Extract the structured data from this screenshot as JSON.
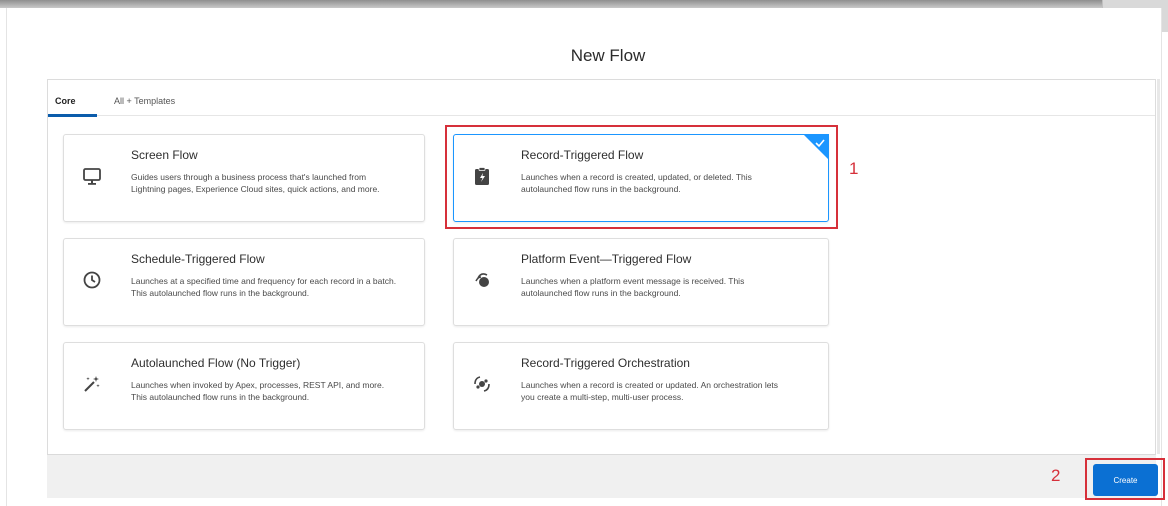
{
  "modal": {
    "title": "New Flow"
  },
  "tabs": [
    {
      "label": "Core",
      "active": true
    },
    {
      "label": "All + Templates",
      "active": false
    }
  ],
  "cards": [
    {
      "title": "Screen Flow",
      "description": "Guides users through a business process that's launched from Lightning pages, Experience Cloud sites, quick actions, and more.",
      "icon": "monitor-icon",
      "selected": false
    },
    {
      "title": "Record-Triggered Flow",
      "description": "Launches when a record is created, updated, or deleted. This autolaunched flow runs in the background.",
      "icon": "clipboard-bolt-icon",
      "selected": true
    },
    {
      "title": "Schedule-Triggered Flow",
      "description": "Launches at a specified time and frequency for each record in a batch. This autolaunched flow runs in the background.",
      "icon": "clock-icon",
      "selected": false
    },
    {
      "title": "Platform Event—Triggered Flow",
      "description": "Launches when a platform event message is received. This autolaunched flow runs in the background.",
      "icon": "platform-event-icon",
      "selected": false
    },
    {
      "title": "Autolaunched Flow (No Trigger)",
      "description": "Launches when invoked by Apex, processes, REST API, and more. This autolaunched flow runs in the background.",
      "icon": "magic-wand-icon",
      "selected": false
    },
    {
      "title": "Record-Triggered Orchestration",
      "description": "Launches when a record is created or updated. An orchestration lets you create a multi-step, multi-user process.",
      "icon": "orchestration-icon",
      "selected": false
    }
  ],
  "annotations": {
    "step1": "1",
    "step2": "2",
    "color": "#d6303a"
  },
  "footer": {
    "create_label": "Create"
  },
  "colors": {
    "brand": "#0b70d3",
    "selected_border": "#1b96ff"
  }
}
